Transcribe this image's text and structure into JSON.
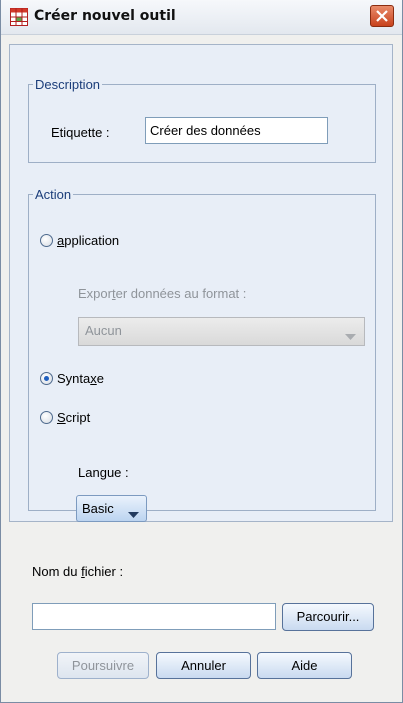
{
  "window": {
    "title": "Créer nouvel outil"
  },
  "description": {
    "legend": "Description",
    "label_text": "Etiquette :",
    "label_value": "Créer des données"
  },
  "action": {
    "legend": "Action",
    "application": {
      "label": "application",
      "checked": false
    },
    "export_format_label": "Exporter données au format :",
    "export_format_value": "Aucun",
    "syntax": {
      "label": "Syntaxe",
      "checked": true
    },
    "script": {
      "label": "Script",
      "checked": false
    },
    "language_label": "Langue :",
    "language_value": "Basic"
  },
  "file": {
    "label": "Nom du fichier :",
    "value": "",
    "browse_label": "Parcourir..."
  },
  "buttons": {
    "continue_label": "Poursuivre",
    "cancel_label": "Annuler",
    "help_label": "Aide"
  },
  "colors": {
    "panel_bg": "#e8eef7",
    "dialog_bg": "#f0f0ee",
    "close_button": "#c8421d",
    "legend_text": "#1b3d7a"
  }
}
